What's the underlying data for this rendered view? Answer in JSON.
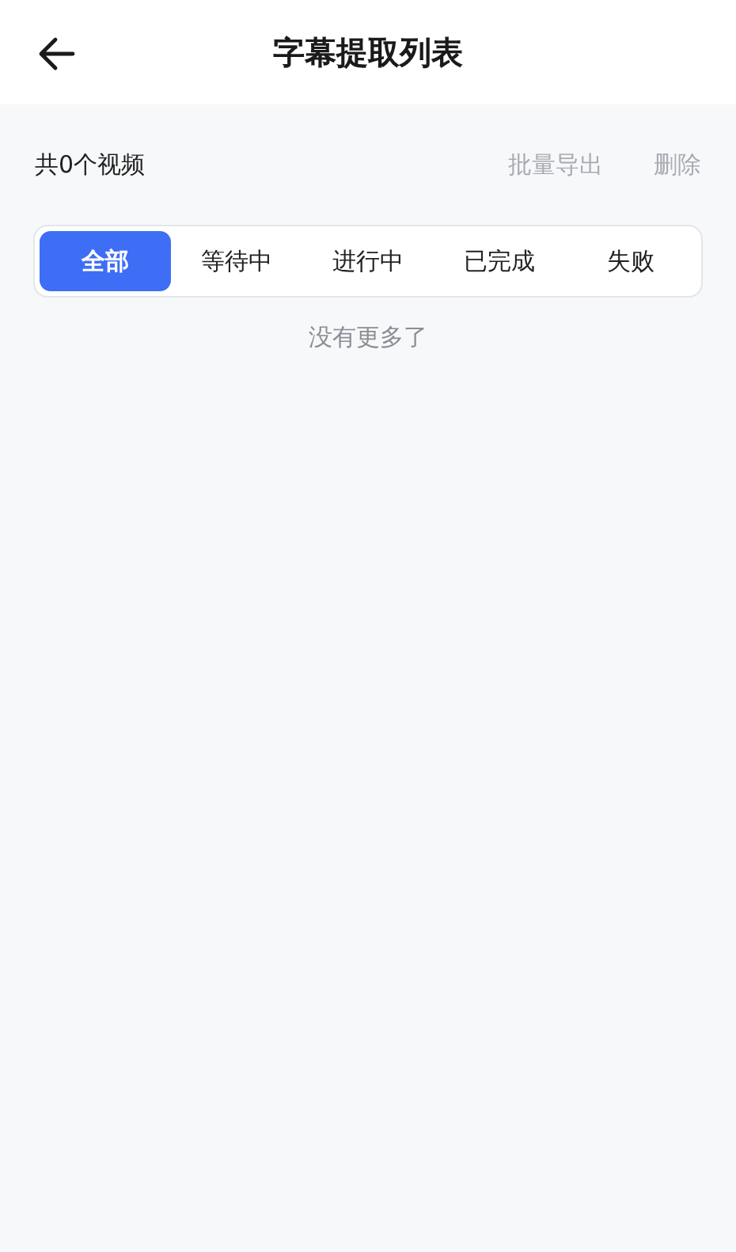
{
  "header": {
    "title": "字幕提取列表"
  },
  "toolbar": {
    "count": "共0个视频",
    "actions": [
      {
        "label": "批量导出",
        "disabled": true
      },
      {
        "label": "删除",
        "disabled": true
      }
    ]
  },
  "tabs": [
    {
      "label": "全部",
      "selected": true
    },
    {
      "label": "等待中",
      "selected": false
    },
    {
      "label": "进行中",
      "selected": false
    },
    {
      "label": "已完成",
      "selected": false
    },
    {
      "label": "失败",
      "selected": false
    }
  ],
  "list_footer": "没有更多了"
}
